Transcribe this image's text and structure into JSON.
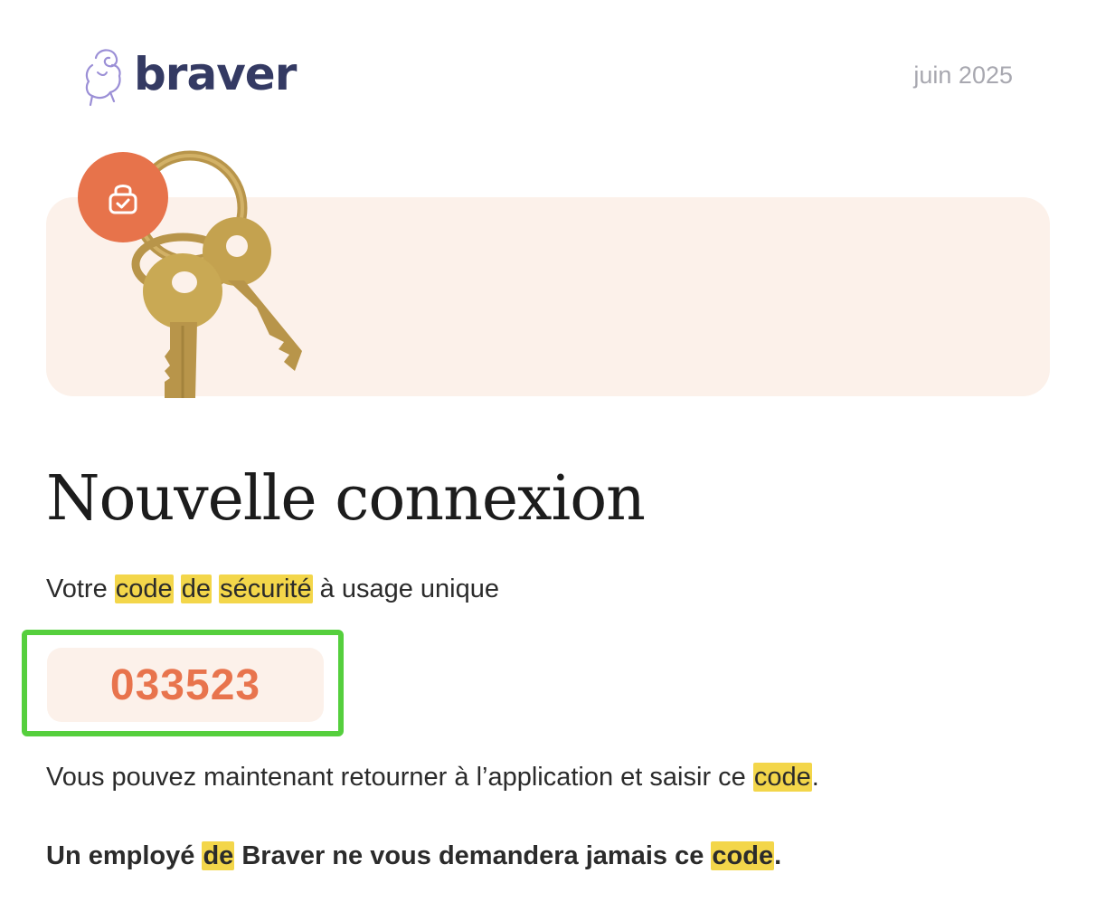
{
  "header": {
    "brand": "braver",
    "date": "juin 2025"
  },
  "hero": {
    "illustration": "keys-illustration",
    "badge_icon": "lock-check-icon"
  },
  "main": {
    "title": "Nouvelle connexion",
    "subtitle": {
      "part1": "Votre ",
      "hl1": "code",
      "space1": " ",
      "hl2": "de",
      "space2": " ",
      "hl3": "sécurité",
      "part2": " à usage unique"
    },
    "code": "033523",
    "info": {
      "text": "Vous pouvez maintenant retourner à l’application et saisir ce ",
      "hl": "code",
      "end": "."
    },
    "warning": {
      "part1": "Un employé ",
      "hl1": "de",
      "part2": " Braver ne vous demandera jamais ce ",
      "hl2": "code",
      "end": "."
    }
  },
  "colors": {
    "brand": "#343a63",
    "accent": "#e8744d",
    "hero_bg": "#fcf1ea",
    "highlight": "#f3d64a",
    "frame": "#55cf3d"
  }
}
